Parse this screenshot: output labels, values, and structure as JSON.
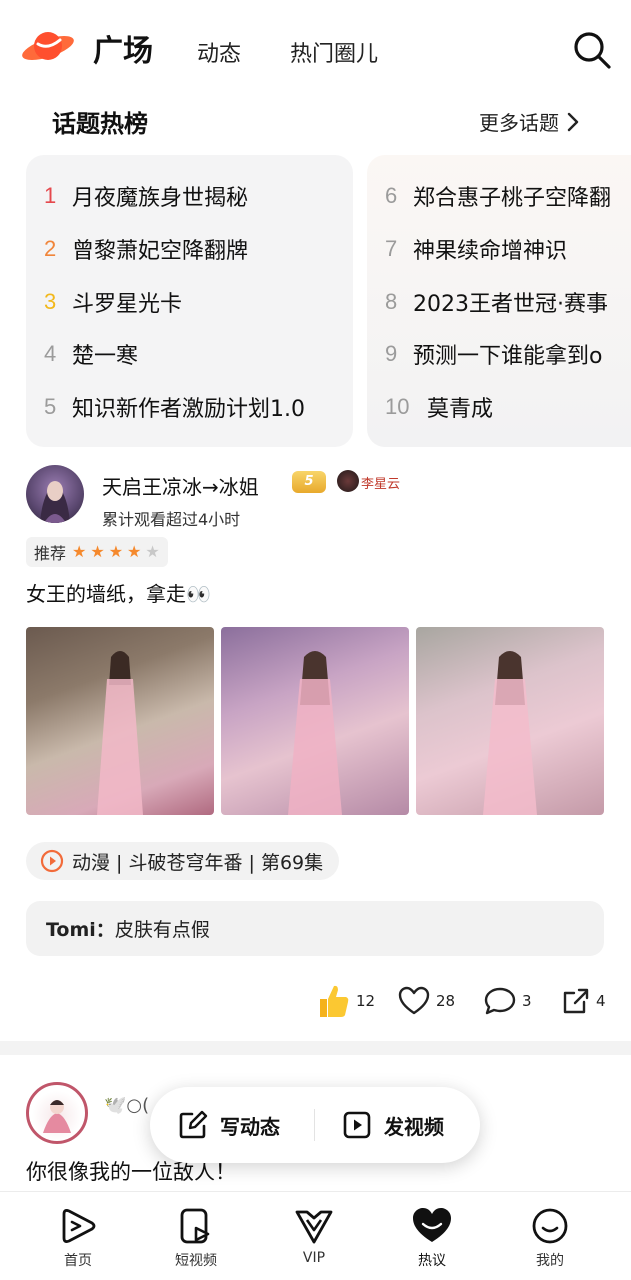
{
  "header": {
    "title": "广场",
    "tabs": [
      {
        "label": "动态"
      },
      {
        "label": "热门圈儿"
      }
    ],
    "accent": "#ff5a36"
  },
  "topics": {
    "title": "话题热榜",
    "more_label": "更多话题",
    "items": [
      {
        "rank": "1",
        "text": "月夜魔族身世揭秘",
        "color": "#e5484d"
      },
      {
        "rank": "2",
        "text": "曾黎萧妃空降翻牌",
        "color": "#f0853a"
      },
      {
        "rank": "3",
        "text": "斗罗星光卡",
        "color": "#f2b81c"
      },
      {
        "rank": "4",
        "text": "楚一寒",
        "color": "#9b9b9b"
      },
      {
        "rank": "5",
        "text": "知识新作者激励计划1.0",
        "color": "#9b9b9b"
      },
      {
        "rank": "6",
        "text": "郑合惠子桃子空降翻",
        "color": "#9b9b9b"
      },
      {
        "rank": "7",
        "text": "神果续命增神识",
        "color": "#9b9b9b"
      },
      {
        "rank": "8",
        "text": "2023王者世冠·赛事",
        "color": "#9b9b9b"
      },
      {
        "rank": "9",
        "text": "预测一下谁能拿到o",
        "color": "#9b9b9b"
      },
      {
        "rank": "10",
        "text": "莫青成",
        "color": "#9b9b9b"
      }
    ]
  },
  "post1": {
    "username": "天启王凉冰→冰姐",
    "level_badge": "5",
    "tag_name": "李星云",
    "subtitle": "累计观看超过4小时",
    "rec_label": "推荐",
    "stars": {
      "filled": 4,
      "total": 5
    },
    "text": "女王的墙纸，拿走👀",
    "anime_label": "动漫 | 斗破苍穹年番 | 第69集",
    "comment_user": "Tomi：",
    "comment_text": "皮肤有点假",
    "actions": {
      "likes": "12",
      "favorites": "28",
      "comments": "3",
      "shares": "4"
    }
  },
  "post2": {
    "name": "🕊️○(",
    "text": "你很像我的一位敌人！"
  },
  "fab": {
    "post_label": "写动态",
    "video_label": "发视频"
  },
  "nav": [
    {
      "label": "首页"
    },
    {
      "label": "短视频"
    },
    {
      "label": "VIP"
    },
    {
      "label": "热议"
    },
    {
      "label": "我的"
    }
  ]
}
